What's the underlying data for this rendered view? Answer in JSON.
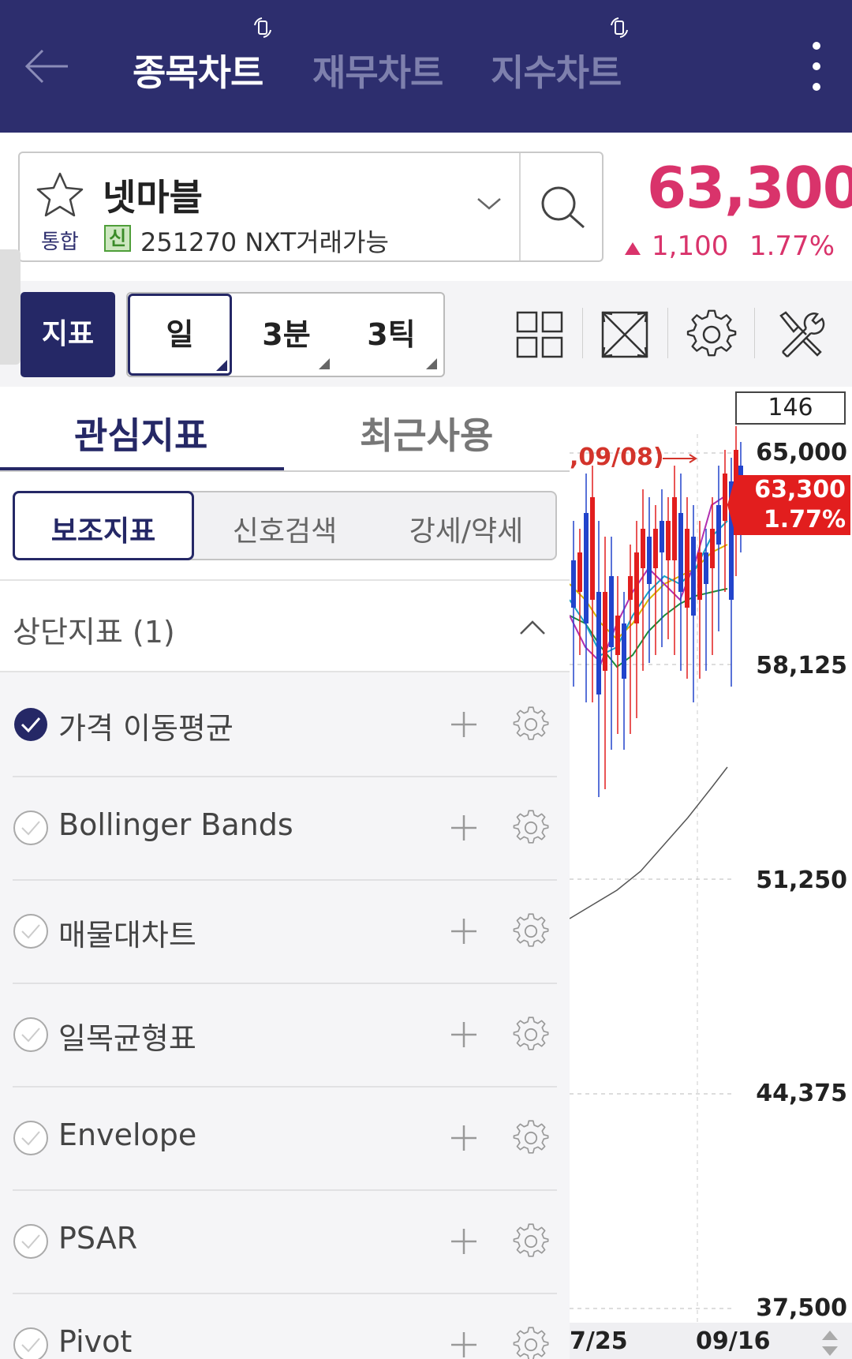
{
  "header": {
    "tabs": [
      {
        "label": "종목차트"
      },
      {
        "label": "재무차트"
      },
      {
        "label": "지수차트"
      }
    ]
  },
  "stock": {
    "name": "넷마블",
    "market_label": "통합",
    "badge": "신",
    "code_info": "251270 NXT거래가능",
    "price": "63,300",
    "change": "1,100",
    "change_pct": "1.77%"
  },
  "toolbar": {
    "indicator_label": "지표",
    "periods": [
      {
        "label": "일"
      },
      {
        "label": "3분"
      },
      {
        "label": "3틱"
      }
    ]
  },
  "panel": {
    "tabs": [
      {
        "label": "관심지표"
      },
      {
        "label": "최근사용"
      }
    ],
    "segments": [
      {
        "label": "보조지표"
      },
      {
        "label": "신호검색"
      },
      {
        "label": "강세/약세"
      }
    ],
    "section_title": "상단지표 (1)",
    "items": [
      {
        "label": "가격 이동평균",
        "checked": true
      },
      {
        "label": "Bollinger Bands",
        "checked": false
      },
      {
        "label": "매물대차트",
        "checked": false
      },
      {
        "label": "일목균형표",
        "checked": false
      },
      {
        "label": "Envelope",
        "checked": false
      },
      {
        "label": "PSAR",
        "checked": false
      },
      {
        "label": "Pivot",
        "checked": false
      }
    ]
  },
  "chart": {
    "count": "146",
    "annotation": ",09/08)",
    "price_tag_value": "63,300",
    "price_tag_pct": "1.77%",
    "y_labels": [
      "65,000",
      "58,125",
      "51,250",
      "44,375",
      "37,500"
    ],
    "x_labels": [
      "7/25",
      "09/16"
    ],
    "colors": {
      "up": "#e21e1e",
      "down": "#2244cc",
      "accent": "#d9336b",
      "brand": "#2d2e6e"
    }
  }
}
